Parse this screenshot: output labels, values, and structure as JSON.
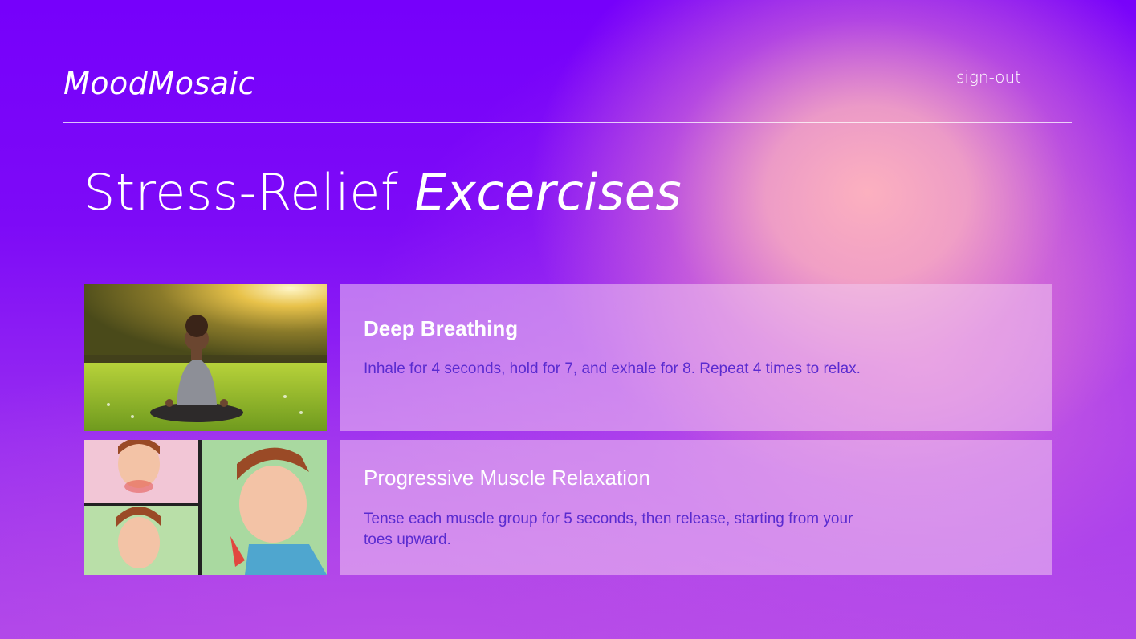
{
  "header": {
    "app_title": "MoodMosaic",
    "sign_out_label": "sign-out"
  },
  "main": {
    "title_plain": "Stress-Relief",
    "title_emphasis": "Excercises",
    "exercises": [
      {
        "title": "Deep Breathing",
        "description": "Inhale for 4 seconds, hold for 7, and exhale for 8. Repeat 4 times to relax.",
        "image": "woman-meditating-in-sunny-park"
      },
      {
        "title": "Progressive Muscle Relaxation",
        "description": "Tense each muscle group for 5 seconds, then release, starting from your toes upward.",
        "image": "man-relaxing-neck-muscles-illustration"
      }
    ]
  },
  "colors": {
    "background_top": "#7600fb",
    "glow": "#fcb0bf",
    "description_text": "#5a2bd0"
  }
}
